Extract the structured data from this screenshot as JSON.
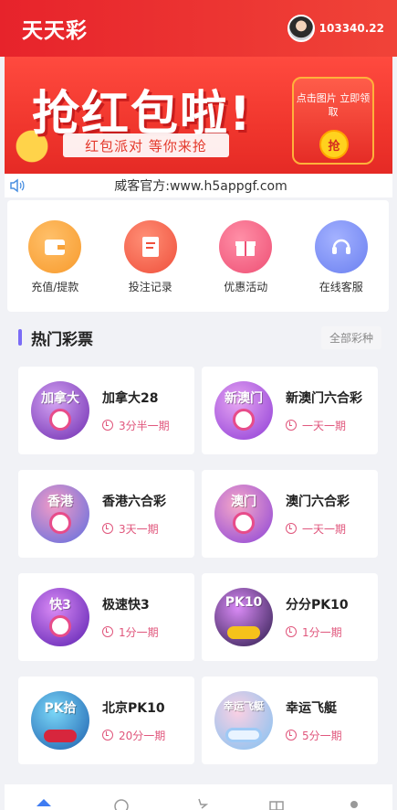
{
  "header": {
    "title": "天天彩",
    "balance": "103340.22"
  },
  "banner": {
    "headline": "抢红包啦!",
    "subline": "红包派对 等你来抢",
    "envelope_text": "点击图片 立即领取",
    "coin_text": "抢"
  },
  "notice": {
    "text": "威客官方:www.h5appgf.com"
  },
  "menu": [
    {
      "label": "充值/提款",
      "icon": "wallet-icon",
      "color": "#f7a23a"
    },
    {
      "label": "投注记录",
      "icon": "record-icon",
      "color": "#f2624c"
    },
    {
      "label": "优惠活动",
      "icon": "gift-icon",
      "color": "#f0577b"
    },
    {
      "label": "在线客服",
      "icon": "headset-icon",
      "color": "#6f86f5"
    }
  ],
  "section": {
    "title": "热门彩票",
    "all_label": "全部彩种"
  },
  "lotteries": [
    {
      "name": "加拿大28",
      "period": "3分半一期",
      "badge": "加拿大",
      "color1": "#b57be6",
      "color2": "#6d2bb0"
    },
    {
      "name": "新澳门六合彩",
      "period": "一天一期",
      "badge": "新澳门",
      "color1": "#d58be8",
      "color2": "#8d3bd6"
    },
    {
      "name": "香港六合彩",
      "period": "3天一期",
      "badge": "香港",
      "color1": "#f07ab5",
      "color2": "#5b6de0"
    },
    {
      "name": "澳门六合彩",
      "period": "一天一期",
      "badge": "澳门",
      "color1": "#f58ab7",
      "color2": "#8a42d8"
    },
    {
      "name": "极速快3",
      "period": "1分一期",
      "badge": "快3",
      "color1": "#c65ef0",
      "color2": "#5a1fb0"
    },
    {
      "name": "分分PK10",
      "period": "1分一期",
      "badge": "PK10",
      "color1": "#c456e8",
      "color2": "#2a1a4a"
    },
    {
      "name": "北京PK10",
      "period": "20分一期",
      "badge": "PK拾",
      "color1": "#5cc6f2",
      "color2": "#c21f4a"
    },
    {
      "name": "幸运飞艇",
      "period": "5分一期",
      "badge": "幸运飞艇",
      "color1": "#f6b6d6",
      "color2": "#7fc1f2"
    }
  ],
  "tabbar": [
    {
      "icon": "home-icon",
      "color": "#3f7cf2"
    },
    {
      "icon": "compass-icon",
      "color": "#999999"
    },
    {
      "icon": "star-icon",
      "color": "#999999"
    },
    {
      "icon": "gift-icon",
      "color": "#999999"
    },
    {
      "icon": "user-icon",
      "color": "#999999"
    }
  ]
}
